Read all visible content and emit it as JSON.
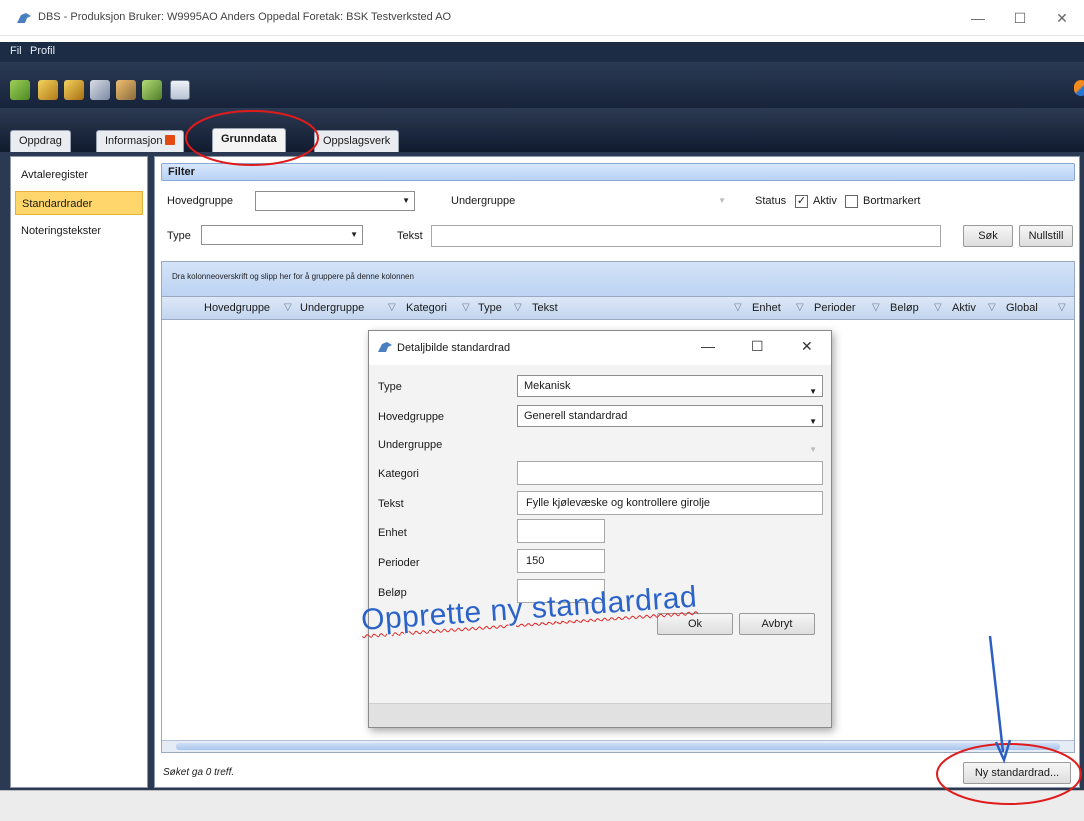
{
  "window": {
    "title": "DBS - Produksjon Bruker: W9995AO Anders Oppedal Foretak: BSK Testverksted AO",
    "minimize": "—",
    "maximize": "☐",
    "close": "✕"
  },
  "menu": {
    "items": [
      "Fil",
      "Profil"
    ]
  },
  "toolbar": {
    "icons": [
      "car-add-icon",
      "tools-icon",
      "tools-small-icon",
      "person-car-icon",
      "person-money-icon",
      "person-green-icon",
      "calendar-icon"
    ]
  },
  "tabs": [
    {
      "label": "Oppdrag",
      "active": false
    },
    {
      "label": "Informasjon",
      "active": false,
      "badge": true
    },
    {
      "label": "Grunndata",
      "active": true
    },
    {
      "label": "Oppslagsverk",
      "active": false
    }
  ],
  "sidebar": {
    "items": [
      {
        "label": "Avtaleregister",
        "active": false
      },
      {
        "label": "Standardrader",
        "active": true
      },
      {
        "label": "Noteringstekster",
        "active": false
      }
    ]
  },
  "filter": {
    "header": "Filter",
    "hovedgruppe_label": "Hovedgruppe",
    "undergruppe_label": "Undergruppe",
    "status_label": "Status",
    "aktiv_label": "Aktiv",
    "aktiv_checked": true,
    "bortmarkert_label": "Bortmarkert",
    "bortmarkert_checked": false,
    "type_label": "Type",
    "tekst_label": "Tekst",
    "tekst_value": "",
    "search_button": "Søk",
    "reset_button": "Nullstill"
  },
  "grid": {
    "group_hint": "Dra kolonneoverskrift og slipp her for å gruppere på denne kolonnen",
    "columns": [
      "Hovedgruppe",
      "Undergruppe",
      "Kategori",
      "Type",
      "Tekst",
      "Enhet",
      "Perioder",
      "Beløp",
      "Aktiv",
      "Global"
    ],
    "rows": []
  },
  "status": {
    "result_text": "Søket ga 0 treff."
  },
  "actions": {
    "new_row_button": "Ny standardrad..."
  },
  "dialog": {
    "title": "Detaljbilde standardrad",
    "minimize": "—",
    "maximize": "☐",
    "close": "✕",
    "fields": {
      "type_label": "Type",
      "type_value": "Mekanisk",
      "hovedgruppe_label": "Hovedgruppe",
      "hovedgruppe_value": "Generell standardrad",
      "undergruppe_label": "Undergruppe",
      "undergruppe_value": "",
      "kategori_label": "Kategori",
      "kategori_value": "",
      "tekst_label": "Tekst",
      "tekst_value": "Fylle kjølevæske og kontrollere girolje",
      "enhet_label": "Enhet",
      "enhet_value": "",
      "perioder_label": "Perioder",
      "perioder_value": "150",
      "belop_label": "Beløp",
      "belop_value": ""
    },
    "ok_button": "Ok",
    "cancel_button": "Avbryt"
  },
  "annotation": {
    "text": "Opprette ny standardrad",
    "text_color": "#2b63c8",
    "circle_color": "#e01b1b",
    "arrow_color": "#2b5fc4"
  },
  "colors": {
    "chrome_dark": "#1d2c45",
    "active_sidebar": "#ffd66b",
    "filter_header": "#c8dcf6",
    "badge": "#e14b12"
  }
}
